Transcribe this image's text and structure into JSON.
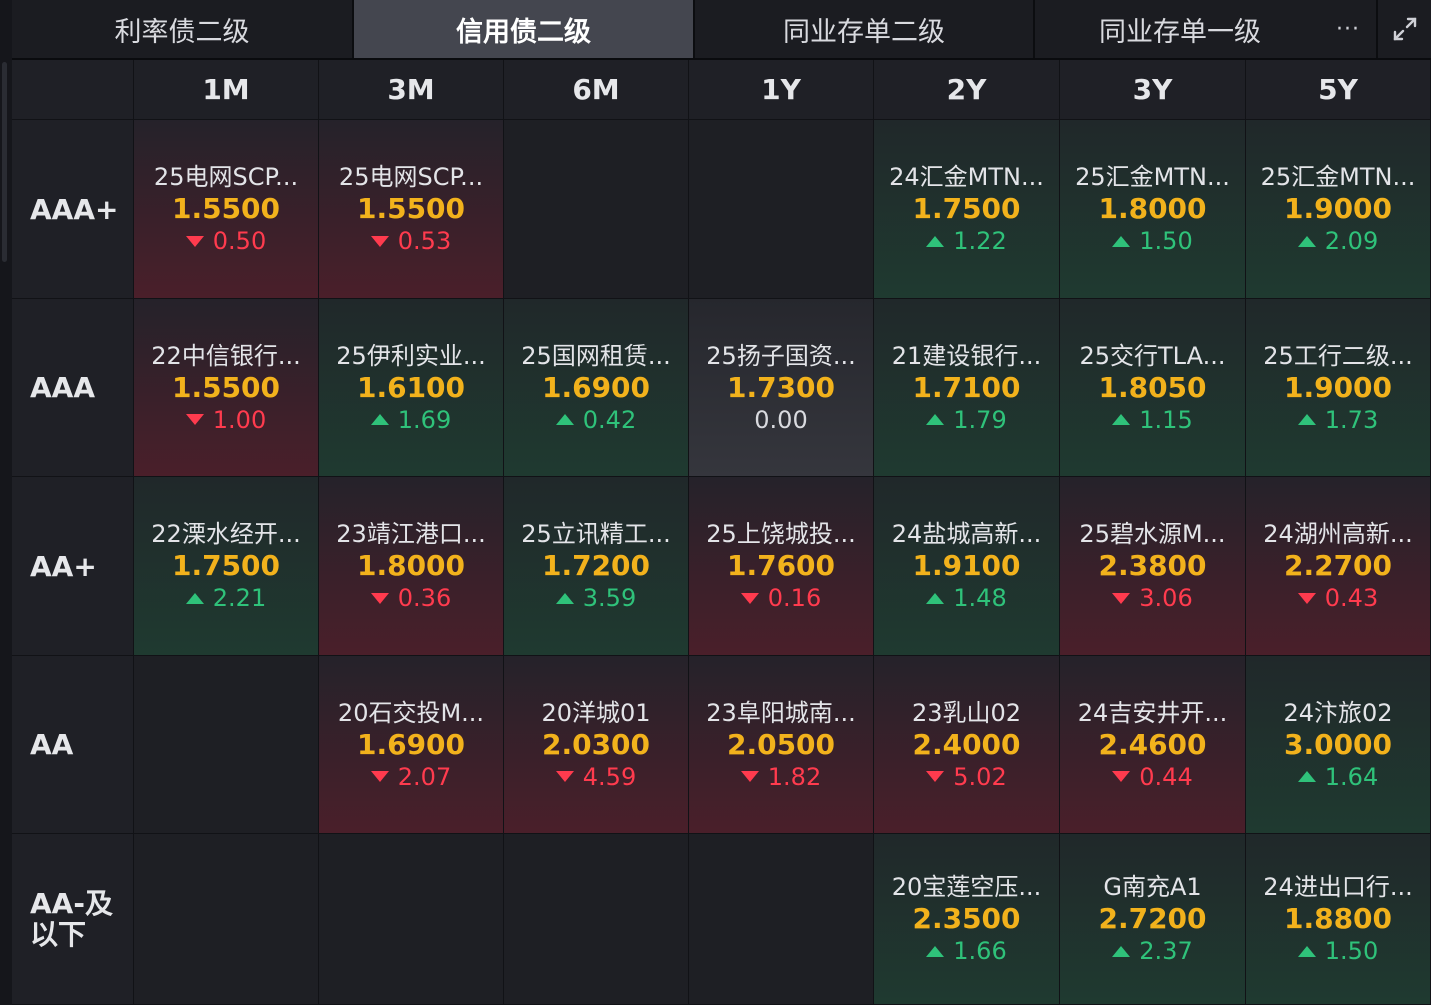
{
  "tabs": [
    {
      "label": "利率债二级",
      "active": false
    },
    {
      "label": "信用债二级",
      "active": true
    },
    {
      "label": "同业存单二级",
      "active": false
    },
    {
      "label": "同业存单一级",
      "active": false
    }
  ],
  "more_label": "···",
  "tenors": [
    "1M",
    "3M",
    "6M",
    "1Y",
    "2Y",
    "3Y",
    "5Y"
  ],
  "colors": {
    "up": "#2fc27a",
    "down": "#ff3b4e",
    "rate": "#f2b21c"
  },
  "rows": [
    {
      "rating": "AAA+",
      "cells": [
        {
          "name": "25电网SCP...",
          "rate": "1.5500",
          "change": "0.50",
          "dir": "down"
        },
        {
          "name": "25电网SCP...",
          "rate": "1.5500",
          "change": "0.53",
          "dir": "down"
        },
        null,
        null,
        {
          "name": "24汇金MTN...",
          "rate": "1.7500",
          "change": "1.22",
          "dir": "up"
        },
        {
          "name": "25汇金MTN...",
          "rate": "1.8000",
          "change": "1.50",
          "dir": "up"
        },
        {
          "name": "25汇金MTN...",
          "rate": "1.9000",
          "change": "2.09",
          "dir": "up"
        }
      ]
    },
    {
      "rating": "AAA",
      "cells": [
        {
          "name": "22中信银行...",
          "rate": "1.5500",
          "change": "1.00",
          "dir": "down"
        },
        {
          "name": "25伊利实业...",
          "rate": "1.6100",
          "change": "1.69",
          "dir": "up"
        },
        {
          "name": "25国网租赁...",
          "rate": "1.6900",
          "change": "0.42",
          "dir": "up"
        },
        {
          "name": "25扬子国资...",
          "rate": "1.7300",
          "change": "0.00",
          "dir": "flat"
        },
        {
          "name": "21建设银行...",
          "rate": "1.7100",
          "change": "1.79",
          "dir": "up"
        },
        {
          "name": "25交行TLA...",
          "rate": "1.8050",
          "change": "1.15",
          "dir": "up"
        },
        {
          "name": "25工行二级...",
          "rate": "1.9000",
          "change": "1.73",
          "dir": "up"
        }
      ]
    },
    {
      "rating": "AA+",
      "cells": [
        {
          "name": "22溧水经开...",
          "rate": "1.7500",
          "change": "2.21",
          "dir": "up"
        },
        {
          "name": "23靖江港口...",
          "rate": "1.8000",
          "change": "0.36",
          "dir": "down"
        },
        {
          "name": "25立讯精工...",
          "rate": "1.7200",
          "change": "3.59",
          "dir": "up"
        },
        {
          "name": "25上饶城投...",
          "rate": "1.7600",
          "change": "0.16",
          "dir": "down"
        },
        {
          "name": "24盐城高新...",
          "rate": "1.9100",
          "change": "1.48",
          "dir": "up"
        },
        {
          "name": "25碧水源M...",
          "rate": "2.3800",
          "change": "3.06",
          "dir": "down"
        },
        {
          "name": "24湖州高新...",
          "rate": "2.2700",
          "change": "0.43",
          "dir": "down"
        }
      ]
    },
    {
      "rating": "AA",
      "cells": [
        null,
        {
          "name": "20石交投M...",
          "rate": "1.6900",
          "change": "2.07",
          "dir": "down"
        },
        {
          "name": "20洋城01",
          "rate": "2.0300",
          "change": "4.59",
          "dir": "down"
        },
        {
          "name": "23阜阳城南...",
          "rate": "2.0500",
          "change": "1.82",
          "dir": "down"
        },
        {
          "name": "23乳山02",
          "rate": "2.4000",
          "change": "5.02",
          "dir": "down"
        },
        {
          "name": "24吉安井开...",
          "rate": "2.4600",
          "change": "0.44",
          "dir": "down"
        },
        {
          "name": "24汴旅02",
          "rate": "3.0000",
          "change": "1.64",
          "dir": "up"
        }
      ]
    },
    {
      "rating": "AA-及\n以下",
      "rating_lines": [
        "AA-及",
        "以下"
      ],
      "cells": [
        null,
        null,
        null,
        null,
        {
          "name": "20宝莲空压...",
          "rate": "2.3500",
          "change": "1.66",
          "dir": "up"
        },
        {
          "name": "G南充A1",
          "rate": "2.7200",
          "change": "2.37",
          "dir": "up"
        },
        {
          "name": "24进出口行...",
          "rate": "1.8800",
          "change": "1.50",
          "dir": "up"
        }
      ]
    }
  ]
}
